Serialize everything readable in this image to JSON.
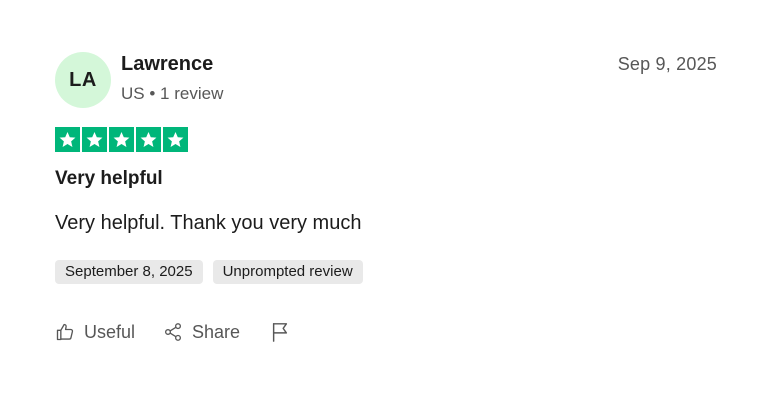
{
  "reviewer": {
    "initials": "LA",
    "name": "Lawrence",
    "country": "US",
    "separator": "•",
    "review_count": "1 review",
    "avatar_color": "#d4f7d9"
  },
  "review": {
    "date": "Sep 9, 2025",
    "rating": 5,
    "rating_max": 5,
    "star_color": "#00b67a",
    "title": "Very helpful",
    "text": "Very helpful. Thank you very much",
    "tags": [
      "September 8, 2025",
      "Unprompted review"
    ]
  },
  "actions": {
    "useful_label": "Useful",
    "share_label": "Share",
    "useful_icon": "thumbs-up-icon",
    "share_icon": "share-icon",
    "report_icon": "flag-icon"
  }
}
